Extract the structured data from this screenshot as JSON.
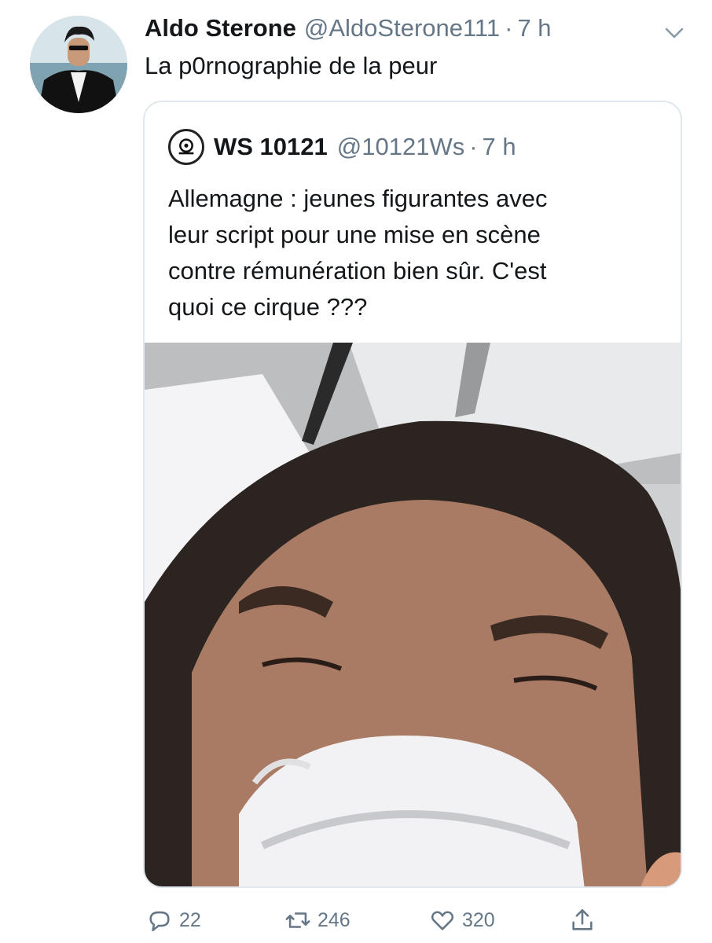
{
  "tweet": {
    "author_name": "Aldo Sterone",
    "author_handle": "@AldoSterone111",
    "separator": "·",
    "time": "7 h",
    "text": "La p0rnographie de la peur",
    "avatar_icon": "profile-photo-man-in-suit",
    "caret_icon": "chevron-down-icon"
  },
  "quoted": {
    "author_name": "WS 10121",
    "author_handle": "@10121Ws",
    "separator": "·",
    "time": "7 h",
    "text": "Allemagne : jeunes figurantes avec\nleur script pour une mise en scène\ncontre rémunération bien sûr. C'est\nquoi ce cirque ???",
    "avatar_icon": "ws10121-logo-icon",
    "media_description_icon": "video-thumbnail-woman-with-mask"
  },
  "actions": {
    "reply_count": "22",
    "retweet_count": "246",
    "like_count": "320",
    "reply_icon": "reply-icon",
    "retweet_icon": "retweet-icon",
    "like_icon": "heart-icon",
    "share_icon": "share-icon"
  },
  "colors": {
    "text_primary": "#14171a",
    "text_secondary": "#657786",
    "border": "#e1e8ed"
  }
}
